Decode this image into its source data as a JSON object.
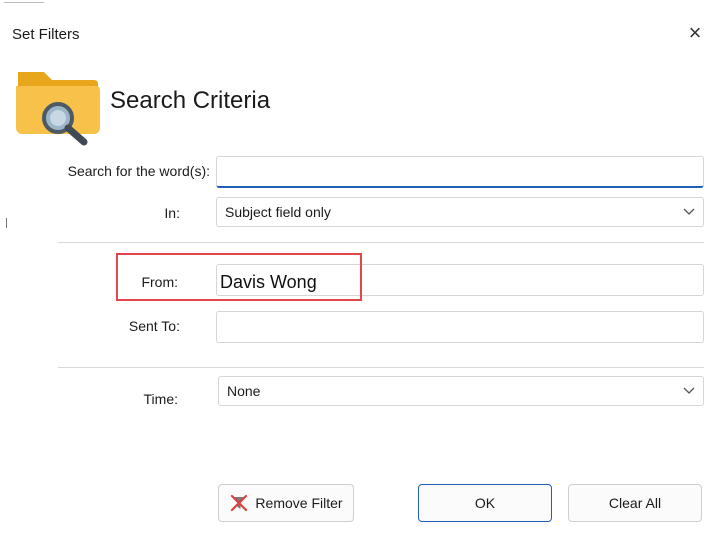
{
  "dialog": {
    "title": "Set Filters",
    "close_glyph": "×",
    "heading": "Search Criteria",
    "icon": "folder-search-icon"
  },
  "form": {
    "search_label": "Search for the word(s):",
    "search_value": "",
    "in_label": "In:",
    "in_value": "Subject field only",
    "from_label": "From:",
    "from_value": "Davis Wong",
    "sent_to_label": "Sent To:",
    "sent_to_value": "",
    "time_label": "Time:",
    "time_value": "None"
  },
  "buttons": {
    "remove_filter": "Remove Filter",
    "ok": "OK",
    "clear_all": "Clear All"
  },
  "colors": {
    "accent": "#1f5fb8",
    "highlight": "#e0464c",
    "folder": "#f5b82e"
  }
}
